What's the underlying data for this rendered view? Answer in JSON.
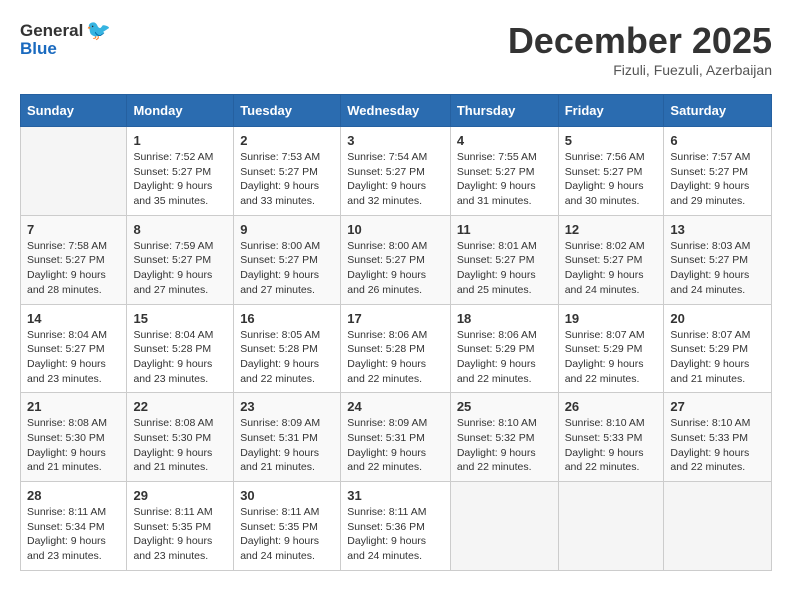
{
  "logo": {
    "general": "General",
    "blue": "Blue"
  },
  "title": {
    "month_year": "December 2025",
    "location": "Fizuli, Fuezuli, Azerbaijan"
  },
  "headers": [
    "Sunday",
    "Monday",
    "Tuesday",
    "Wednesday",
    "Thursday",
    "Friday",
    "Saturday"
  ],
  "weeks": [
    [
      {
        "day": "",
        "info": ""
      },
      {
        "day": "1",
        "info": "Sunrise: 7:52 AM\nSunset: 5:27 PM\nDaylight: 9 hours\nand 35 minutes."
      },
      {
        "day": "2",
        "info": "Sunrise: 7:53 AM\nSunset: 5:27 PM\nDaylight: 9 hours\nand 33 minutes."
      },
      {
        "day": "3",
        "info": "Sunrise: 7:54 AM\nSunset: 5:27 PM\nDaylight: 9 hours\nand 32 minutes."
      },
      {
        "day": "4",
        "info": "Sunrise: 7:55 AM\nSunset: 5:27 PM\nDaylight: 9 hours\nand 31 minutes."
      },
      {
        "day": "5",
        "info": "Sunrise: 7:56 AM\nSunset: 5:27 PM\nDaylight: 9 hours\nand 30 minutes."
      },
      {
        "day": "6",
        "info": "Sunrise: 7:57 AM\nSunset: 5:27 PM\nDaylight: 9 hours\nand 29 minutes."
      }
    ],
    [
      {
        "day": "7",
        "info": "Sunrise: 7:58 AM\nSunset: 5:27 PM\nDaylight: 9 hours\nand 28 minutes."
      },
      {
        "day": "8",
        "info": "Sunrise: 7:59 AM\nSunset: 5:27 PM\nDaylight: 9 hours\nand 27 minutes."
      },
      {
        "day": "9",
        "info": "Sunrise: 8:00 AM\nSunset: 5:27 PM\nDaylight: 9 hours\nand 27 minutes."
      },
      {
        "day": "10",
        "info": "Sunrise: 8:00 AM\nSunset: 5:27 PM\nDaylight: 9 hours\nand 26 minutes."
      },
      {
        "day": "11",
        "info": "Sunrise: 8:01 AM\nSunset: 5:27 PM\nDaylight: 9 hours\nand 25 minutes."
      },
      {
        "day": "12",
        "info": "Sunrise: 8:02 AM\nSunset: 5:27 PM\nDaylight: 9 hours\nand 24 minutes."
      },
      {
        "day": "13",
        "info": "Sunrise: 8:03 AM\nSunset: 5:27 PM\nDaylight: 9 hours\nand 24 minutes."
      }
    ],
    [
      {
        "day": "14",
        "info": "Sunrise: 8:04 AM\nSunset: 5:27 PM\nDaylight: 9 hours\nand 23 minutes."
      },
      {
        "day": "15",
        "info": "Sunrise: 8:04 AM\nSunset: 5:28 PM\nDaylight: 9 hours\nand 23 minutes."
      },
      {
        "day": "16",
        "info": "Sunrise: 8:05 AM\nSunset: 5:28 PM\nDaylight: 9 hours\nand 22 minutes."
      },
      {
        "day": "17",
        "info": "Sunrise: 8:06 AM\nSunset: 5:28 PM\nDaylight: 9 hours\nand 22 minutes."
      },
      {
        "day": "18",
        "info": "Sunrise: 8:06 AM\nSunset: 5:29 PM\nDaylight: 9 hours\nand 22 minutes."
      },
      {
        "day": "19",
        "info": "Sunrise: 8:07 AM\nSunset: 5:29 PM\nDaylight: 9 hours\nand 22 minutes."
      },
      {
        "day": "20",
        "info": "Sunrise: 8:07 AM\nSunset: 5:29 PM\nDaylight: 9 hours\nand 21 minutes."
      }
    ],
    [
      {
        "day": "21",
        "info": "Sunrise: 8:08 AM\nSunset: 5:30 PM\nDaylight: 9 hours\nand 21 minutes."
      },
      {
        "day": "22",
        "info": "Sunrise: 8:08 AM\nSunset: 5:30 PM\nDaylight: 9 hours\nand 21 minutes."
      },
      {
        "day": "23",
        "info": "Sunrise: 8:09 AM\nSunset: 5:31 PM\nDaylight: 9 hours\nand 21 minutes."
      },
      {
        "day": "24",
        "info": "Sunrise: 8:09 AM\nSunset: 5:31 PM\nDaylight: 9 hours\nand 22 minutes."
      },
      {
        "day": "25",
        "info": "Sunrise: 8:10 AM\nSunset: 5:32 PM\nDaylight: 9 hours\nand 22 minutes."
      },
      {
        "day": "26",
        "info": "Sunrise: 8:10 AM\nSunset: 5:33 PM\nDaylight: 9 hours\nand 22 minutes."
      },
      {
        "day": "27",
        "info": "Sunrise: 8:10 AM\nSunset: 5:33 PM\nDaylight: 9 hours\nand 22 minutes."
      }
    ],
    [
      {
        "day": "28",
        "info": "Sunrise: 8:11 AM\nSunset: 5:34 PM\nDaylight: 9 hours\nand 23 minutes."
      },
      {
        "day": "29",
        "info": "Sunrise: 8:11 AM\nSunset: 5:35 PM\nDaylight: 9 hours\nand 23 minutes."
      },
      {
        "day": "30",
        "info": "Sunrise: 8:11 AM\nSunset: 5:35 PM\nDaylight: 9 hours\nand 24 minutes."
      },
      {
        "day": "31",
        "info": "Sunrise: 8:11 AM\nSunset: 5:36 PM\nDaylight: 9 hours\nand 24 minutes."
      },
      {
        "day": "",
        "info": ""
      },
      {
        "day": "",
        "info": ""
      },
      {
        "day": "",
        "info": ""
      }
    ]
  ]
}
